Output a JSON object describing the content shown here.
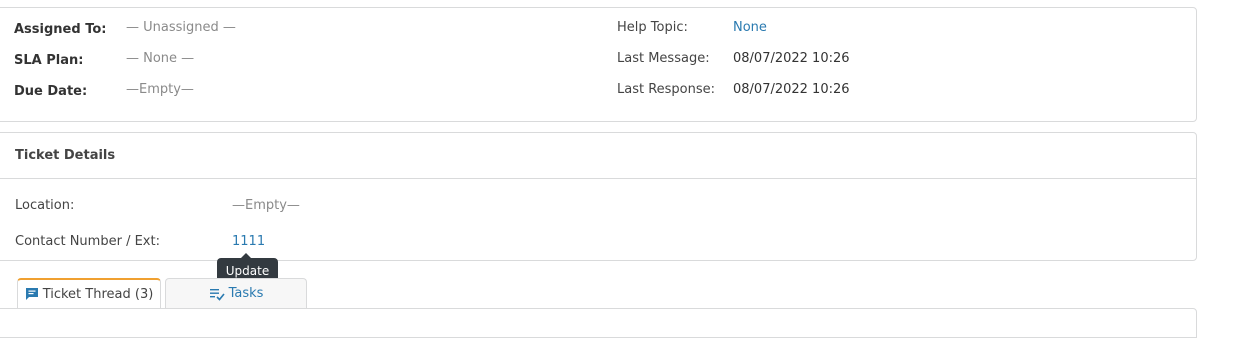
{
  "summary": {
    "assigned_to_label": "Assigned To:",
    "assigned_to_value": "— Unassigned —",
    "sla_plan_label": "SLA Plan:",
    "sla_plan_value": "— None —",
    "due_date_label": "Due Date:",
    "due_date_value": "—Empty—",
    "help_topic_label": "Help Topic:",
    "help_topic_value": "None",
    "last_message_label": "Last Message:",
    "last_message_value": "08/07/2022 10:26",
    "last_response_label": "Last Response:",
    "last_response_value": "08/07/2022 10:26"
  },
  "details": {
    "title": "Ticket Details",
    "location_label": "Location:",
    "location_value": "—Empty—",
    "contact_label": "Contact Number / Ext:",
    "contact_value": "1111",
    "tooltip": "Update"
  },
  "tabs": {
    "thread_label": "Ticket Thread (3)",
    "tasks_label": "Tasks"
  },
  "colors": {
    "link": "#2a7ab0",
    "muted": "#8a8a8a",
    "tooltip_bg": "#333a40",
    "active_tab_accent": "#f0a030"
  },
  "icons": {
    "thread": "chat-bubble-icon",
    "tasks": "checklist-icon"
  }
}
